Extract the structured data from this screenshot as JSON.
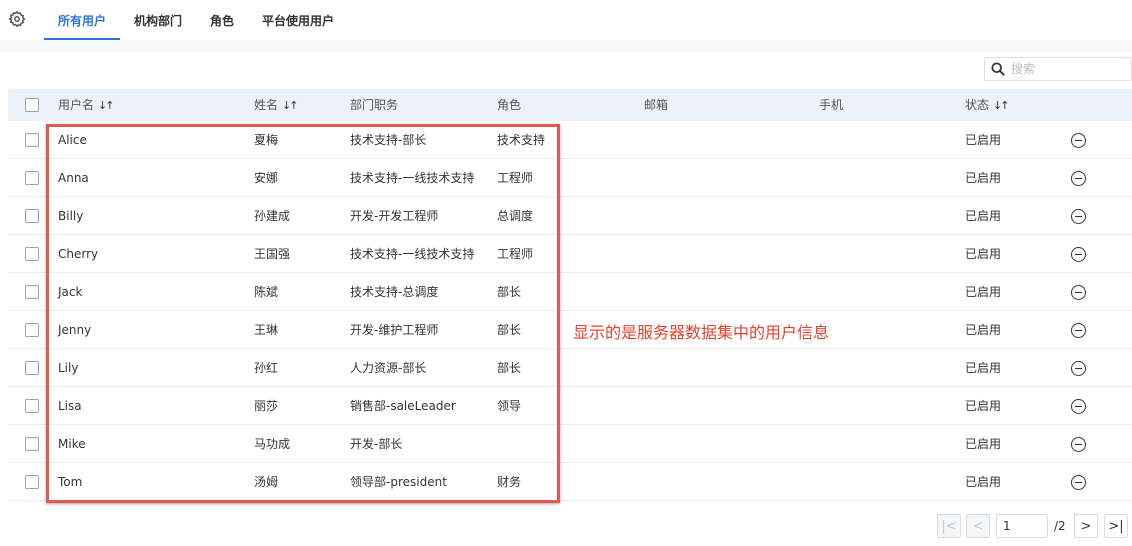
{
  "tabs": [
    {
      "label": "所有用户",
      "active": true
    },
    {
      "label": "机构部门",
      "active": false
    },
    {
      "label": "角色",
      "active": false
    },
    {
      "label": "平台使用用户",
      "active": false
    }
  ],
  "search": {
    "placeholder": "搜索"
  },
  "columns": {
    "username": "用户名",
    "name": "姓名",
    "dept": "部门职务",
    "role": "角色",
    "email": "邮箱",
    "phone": "手机",
    "status": "状态",
    "sort_icon": "↓↑"
  },
  "rows": [
    {
      "username": "Alice",
      "name": "夏梅",
      "dept": "技术支持-部长",
      "role": "技术支持",
      "email": "",
      "phone": "",
      "status": "已启用"
    },
    {
      "username": "Anna",
      "name": "安娜",
      "dept": "技术支持-一线技术支持",
      "role": "工程师",
      "email": "",
      "phone": "",
      "status": "已启用"
    },
    {
      "username": "Billy",
      "name": "孙建成",
      "dept": "开发-开发工程师",
      "role": "总调度",
      "email": "",
      "phone": "",
      "status": "已启用"
    },
    {
      "username": "Cherry",
      "name": "王国强",
      "dept": "技术支持-一线技术支持",
      "role": "工程师",
      "email": "",
      "phone": "",
      "status": "已启用"
    },
    {
      "username": "Jack",
      "name": "陈斌",
      "dept": "技术支持-总调度",
      "role": "部长",
      "email": "",
      "phone": "",
      "status": "已启用"
    },
    {
      "username": "Jenny",
      "name": "王琳",
      "dept": "开发-维护工程师",
      "role": "部长",
      "email": "",
      "phone": "",
      "status": "已启用"
    },
    {
      "username": "Lily",
      "name": "孙红",
      "dept": "人力资源-部长",
      "role": "部长",
      "email": "",
      "phone": "",
      "status": "已启用"
    },
    {
      "username": "Lisa",
      "name": "丽莎",
      "dept": "销售部-saleLeader",
      "role": "领导",
      "email": "",
      "phone": "",
      "status": "已启用"
    },
    {
      "username": "Mike",
      "name": "马功成",
      "dept": "开发-部长",
      "role": "",
      "email": "",
      "phone": "",
      "status": "已启用"
    },
    {
      "username": "Tom",
      "name": "汤姆",
      "dept": "领导部-president",
      "role": "财务",
      "email": "",
      "phone": "",
      "status": "已启用"
    }
  ],
  "annotation": "显示的是服务器数据集中的用户信息",
  "pagination": {
    "current_page": "1",
    "total_label": "/2",
    "first_icon": "|<",
    "prev_icon": "<",
    "next_icon": ">",
    "last_icon": ">|"
  },
  "icons": {
    "settings": "gear-icon",
    "search": "search-icon",
    "row_action": "minus-circle-icon"
  },
  "colors": {
    "accent": "#2f74d9",
    "annotation_red": "#e2442f",
    "header_bg": "#edf2f8"
  }
}
